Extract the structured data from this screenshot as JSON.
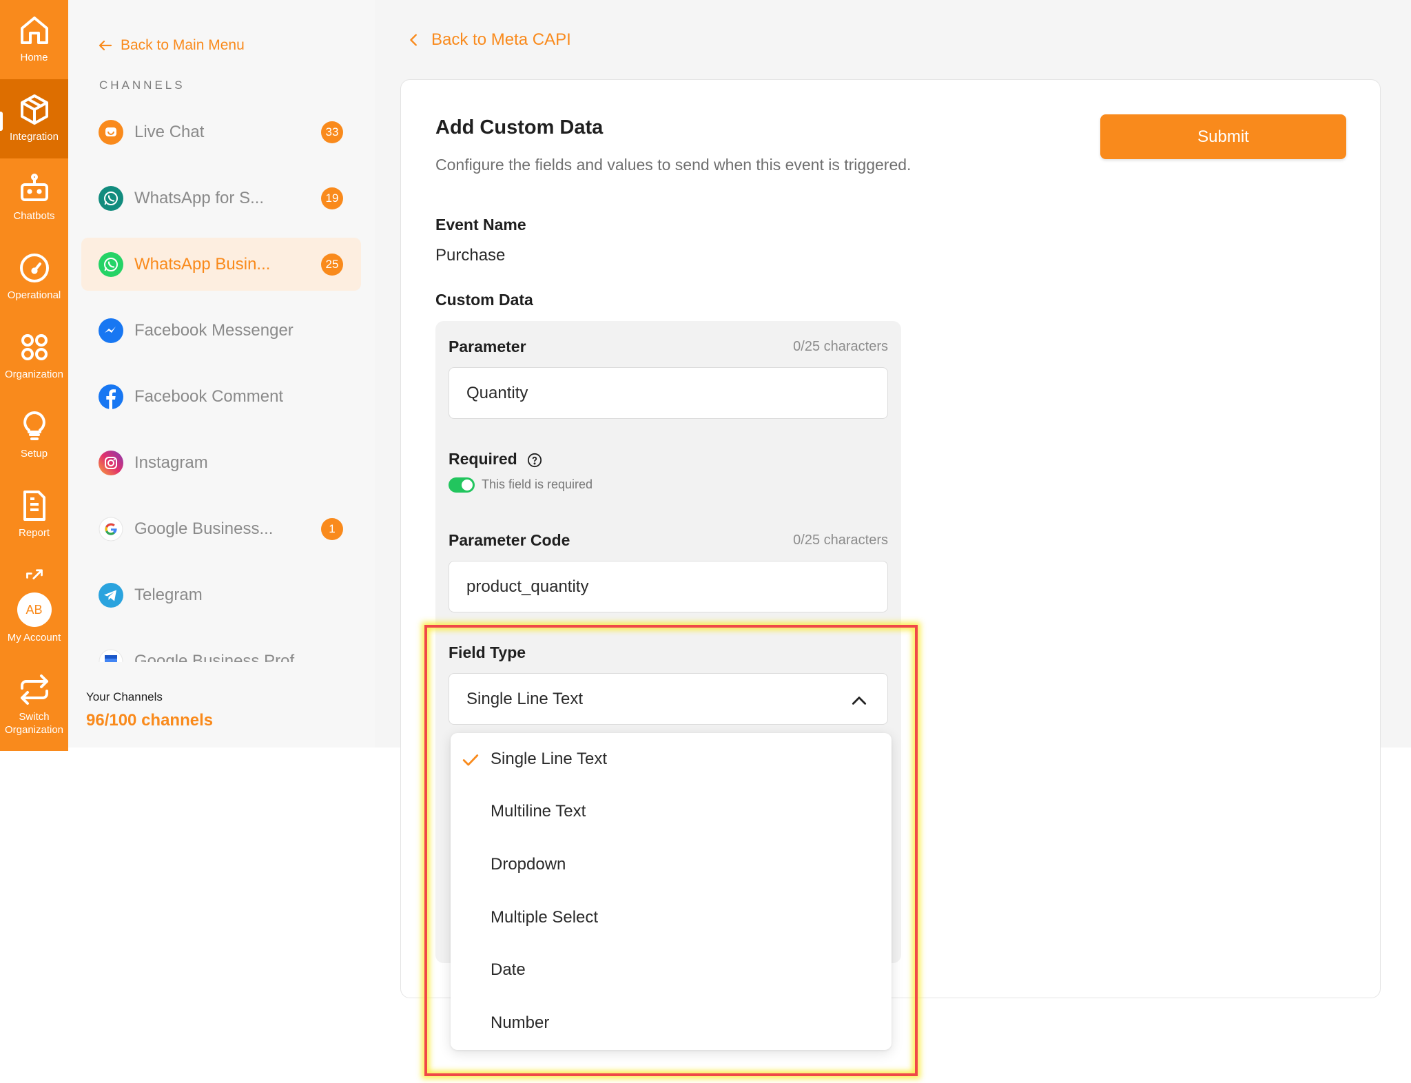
{
  "rail": {
    "home": "Home",
    "integration": "Integration",
    "chatbots": "Chatbots",
    "operational": "Operational",
    "organization": "Organization",
    "setup": "Setup",
    "report": "Report",
    "avatar_initials": "AB",
    "my_account": "My Account",
    "switch_line1": "Switch",
    "switch_line2": "Organization"
  },
  "panel": {
    "back_label": "Back to Main Menu",
    "section_label": "CHANNELS",
    "channels": [
      {
        "name": "Live Chat",
        "badge": "33"
      },
      {
        "name": "WhatsApp for S...",
        "badge": "19"
      },
      {
        "name": "WhatsApp Busin...",
        "badge": "25"
      },
      {
        "name": "Facebook Messenger",
        "badge": ""
      },
      {
        "name": "Facebook Comment",
        "badge": ""
      },
      {
        "name": "Instagram",
        "badge": ""
      },
      {
        "name": "Google Business...",
        "badge": "1"
      },
      {
        "name": "Telegram",
        "badge": ""
      },
      {
        "name": "Google Business Prof",
        "badge": ""
      }
    ],
    "your_channels_label": "Your Channels",
    "channels_count": "96/100 channels"
  },
  "main": {
    "back_label": "Back to Meta CAPI",
    "title": "Add Custom Data",
    "description": "Configure the fields and values to send when this event is triggered.",
    "submit_label": "Submit",
    "event_name_label": "Event Name",
    "event_name_value": "Purchase",
    "custom_data_label": "Custom Data",
    "parameter_label": "Parameter",
    "parameter_count": "0/25 characters",
    "parameter_value": "Quantity",
    "required_label": "Required",
    "required_toggle_text": "This field is required",
    "param_code_label": "Parameter Code",
    "param_code_count": "0/25 characters",
    "param_code_value": "product_quantity",
    "field_type_label": "Field Type",
    "field_type_value": "Single Line Text"
  },
  "dropdown": {
    "options": [
      "Single Line Text",
      "Multiline Text",
      "Dropdown",
      "Multiple Select",
      "Date",
      "Number"
    ],
    "selected": "Single Line Text"
  },
  "colors": {
    "accent": "#f98a1c",
    "rail_active": "#dd6e00",
    "toggle_on": "#22c55e",
    "highlight_border": "#f04848"
  }
}
